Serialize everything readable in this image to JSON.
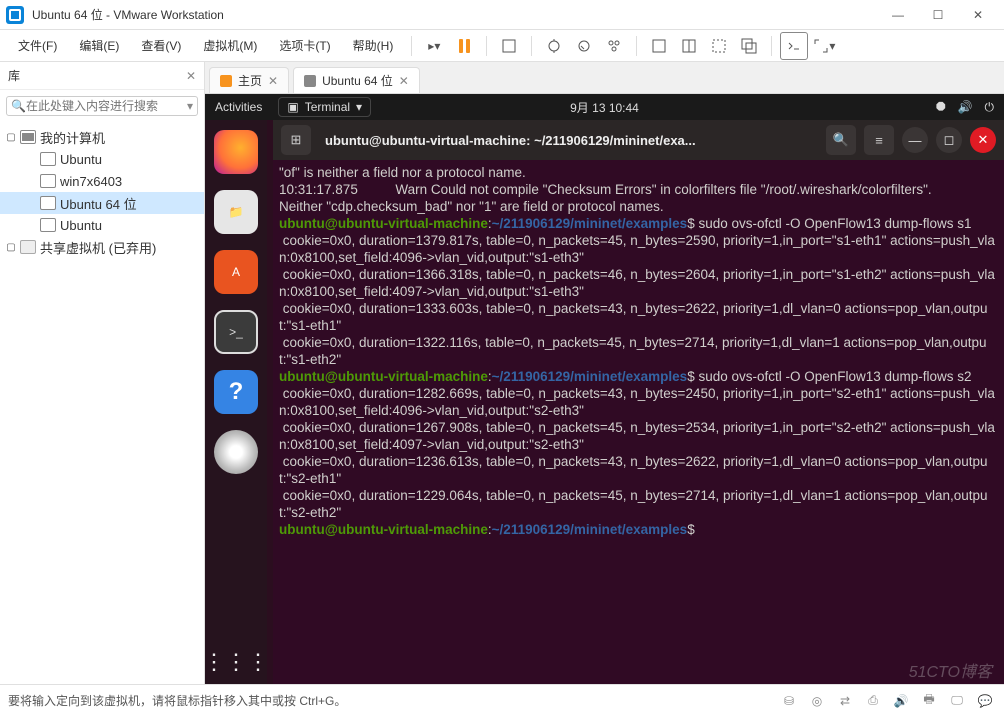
{
  "window": {
    "title": "Ubuntu 64 位 - VMware Workstation"
  },
  "menu": {
    "file": "文件(F)",
    "edit": "编辑(E)",
    "view": "查看(V)",
    "vm": "虚拟机(M)",
    "tabs": "选项卡(T)",
    "help": "帮助(H)"
  },
  "library": {
    "title": "库",
    "search_placeholder": "在此处键入内容进行搜索",
    "root": "我的计算机",
    "items": [
      "Ubuntu",
      "win7x6403",
      "Ubuntu 64 位",
      "Ubuntu"
    ],
    "shared": "共享虚拟机 (已弃用)"
  },
  "tabs": {
    "home": "主页",
    "vm": "Ubuntu 64 位"
  },
  "gnome": {
    "activities": "Activities",
    "app": "Terminal",
    "clock": "9月 13  10:44"
  },
  "terminal": {
    "title": "ubuntu@ubuntu-virtual-machine: ~/211906129/mininet/exa...",
    "user": "ubuntu@ubuntu-virtual-machine",
    "path": "~/211906129/mininet/examples",
    "cmd1": "sudo ovs-ofctl -O OpenFlow13 dump-flows s1",
    "cmd2": "sudo ovs-ofctl -O OpenFlow13 dump-flows s2",
    "pre1": "\"of\" is neither a field nor a protocol name.\n10:31:17.875          Warn Could not compile \"Checksum Errors\" in colorfilters file \"/root/.wireshark/colorfilters\".\nNeither \"cdp.checksum_bad\" nor \"1\" are field or protocol names.",
    "flows_s1": " cookie=0x0, duration=1379.817s, table=0, n_packets=45, n_bytes=2590, priority=1,in_port=\"s1-eth1\" actions=push_vlan:0x8100,set_field:4096->vlan_vid,output:\"s1-eth3\"\n cookie=0x0, duration=1366.318s, table=0, n_packets=46, n_bytes=2604, priority=1,in_port=\"s1-eth2\" actions=push_vlan:0x8100,set_field:4097->vlan_vid,output:\"s1-eth3\"\n cookie=0x0, duration=1333.603s, table=0, n_packets=43, n_bytes=2622, priority=1,dl_vlan=0 actions=pop_vlan,output:\"s1-eth1\"\n cookie=0x0, duration=1322.116s, table=0, n_packets=45, n_bytes=2714, priority=1,dl_vlan=1 actions=pop_vlan,output:\"s1-eth2\"",
    "flows_s2": " cookie=0x0, duration=1282.669s, table=0, n_packets=43, n_bytes=2450, priority=1,in_port=\"s2-eth1\" actions=push_vlan:0x8100,set_field:4096->vlan_vid,output:\"s2-eth3\"\n cookie=0x0, duration=1267.908s, table=0, n_packets=45, n_bytes=2534, priority=1,in_port=\"s2-eth2\" actions=push_vlan:0x8100,set_field:4097->vlan_vid,output:\"s2-eth3\"\n cookie=0x0, duration=1236.613s, table=0, n_packets=43, n_bytes=2622, priority=1,dl_vlan=0 actions=pop_vlan,output:\"s2-eth1\"\n cookie=0x0, duration=1229.064s, table=0, n_packets=45, n_bytes=2714, priority=1,dl_vlan=1 actions=pop_vlan,output:\"s2-eth2\""
  },
  "footer": {
    "hint": "要将输入定向到该虚拟机，请将鼠标指针移入其中或按 Ctrl+G。"
  },
  "watermark": "51CTO博客"
}
